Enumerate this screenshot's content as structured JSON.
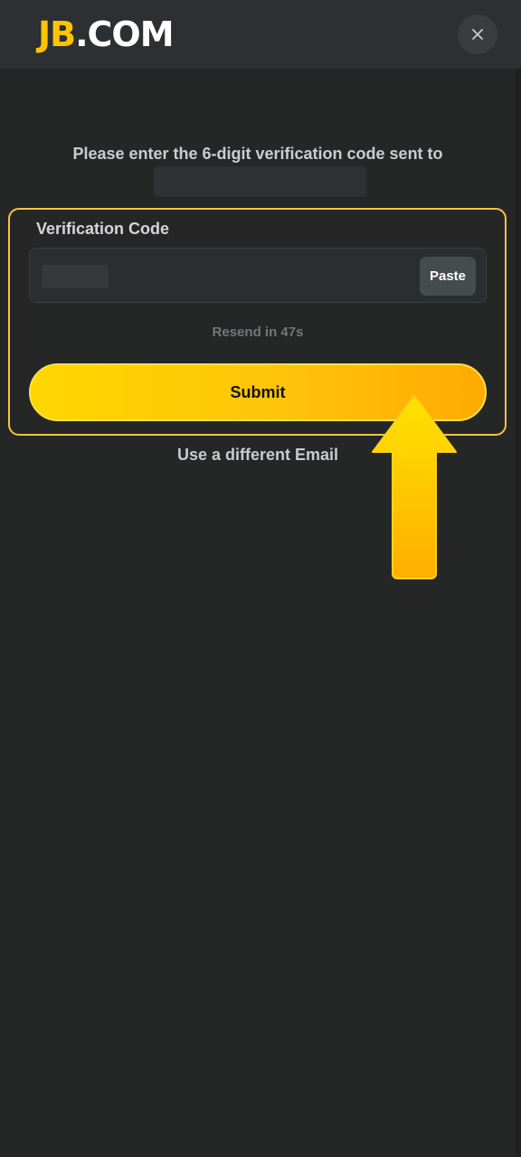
{
  "header": {
    "logo_accent": "JB",
    "logo_rest": ".COM",
    "close_icon": "close-icon"
  },
  "verification": {
    "prompt": "Please enter the 6-digit verification code sent to",
    "field_label": "Verification Code",
    "paste_label": "Paste",
    "resend_text": "Resend in 47s",
    "submit_label": "Submit",
    "alt_email_label": "Use a different Email"
  },
  "colors": {
    "brand_accent": "#ffc400",
    "background": "#252726",
    "highlight_border": "#f6c343",
    "submit_gradient_start": "#ffd600",
    "submit_gradient_end": "#ffaa00"
  },
  "annotation": {
    "arrow_icon": "arrow-up-icon"
  }
}
